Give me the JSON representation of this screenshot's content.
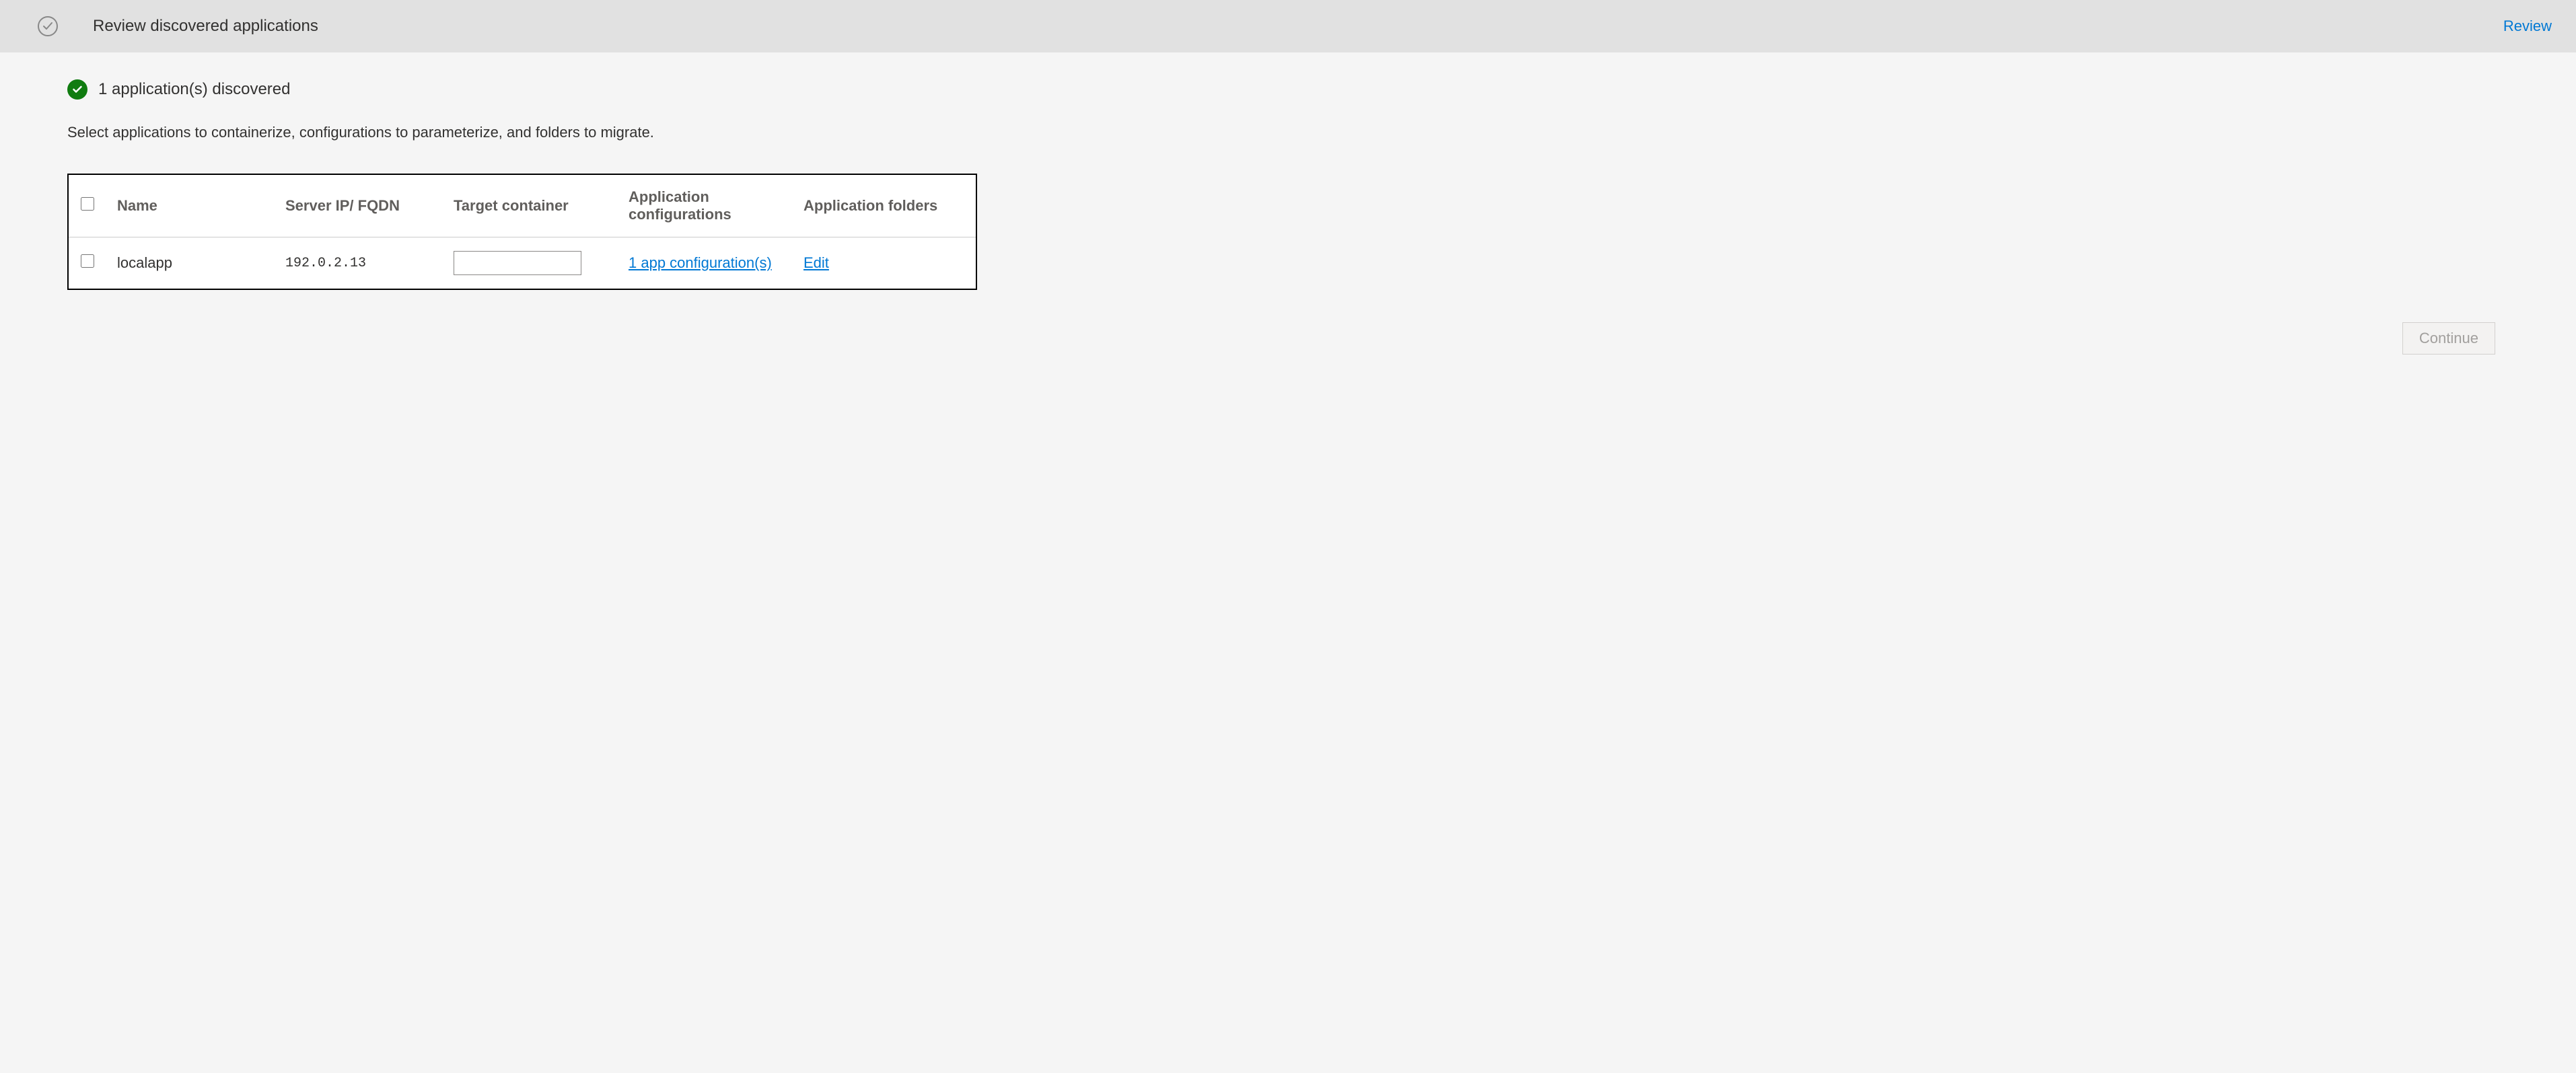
{
  "header": {
    "title": "Review discovered applications",
    "action_label": "Review"
  },
  "status": {
    "message": "1 application(s) discovered"
  },
  "instruction": "Select applications to containerize, configurations to parameterize, and folders to migrate.",
  "table": {
    "columns": {
      "name": "Name",
      "server": "Server IP/ FQDN",
      "target": "Target container",
      "configs": "Application configurations",
      "folders": "Application folders"
    },
    "rows": [
      {
        "name": "localapp",
        "server": "192.0.2.13",
        "target": "",
        "configs_label": "1 app configuration(s)",
        "folders_label": "Edit"
      }
    ]
  },
  "footer": {
    "continue_label": "Continue"
  }
}
